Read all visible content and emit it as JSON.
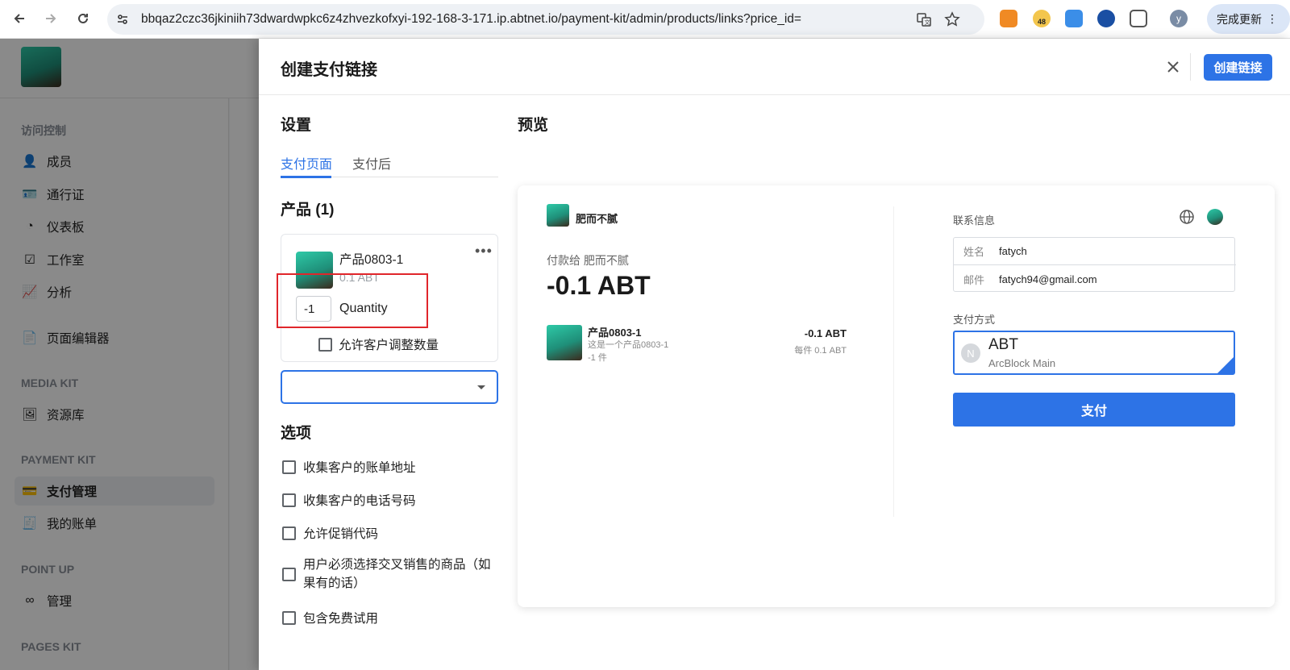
{
  "browser": {
    "url": "bbqaz2czc36jkiniih73dwardwpkc6z4zhvezkofxyi-192-168-3-171.ip.abtnet.io/payment-kit/admin/products/links?price_id=",
    "update_label": "完成更新",
    "profile_initial": "y",
    "badge_count": "48"
  },
  "sidebar": {
    "section_access": "访问控制",
    "members": "成员",
    "passport": "通行证",
    "dashboard": "仪表板",
    "studio": "工作室",
    "analytics": "分析",
    "page_editor": "页面编辑器",
    "section_media": "MEDIA KIT",
    "library": "资源库",
    "section_payment": "PAYMENT KIT",
    "payment_mgmt": "支付管理",
    "my_bills": "我的账单",
    "section_point": "POINT UP",
    "manage": "管理",
    "section_pages": "PAGES KIT"
  },
  "drawer": {
    "title": "创建支付链接",
    "create_button": "创建链接",
    "settings_heading": "设置",
    "preview_heading": "预览",
    "tabs": [
      "支付页面",
      "支付后"
    ],
    "products_heading": "产品 (1)",
    "product": {
      "name": "产品0803-1",
      "price": "0.1 ABT",
      "quantity": "-1",
      "quantity_label": "Quantity",
      "adjust_label": "允许客户调整数量"
    },
    "options_heading": "选项",
    "options": [
      "收集客户的账单地址",
      "收集客户的电话号码",
      "允许促销代码",
      "用户必须选择交叉销售的商品（如果有的话）",
      "包含免费试用"
    ]
  },
  "preview": {
    "store_name": "肥而不腻",
    "pay_to": "付款给 肥而不腻",
    "total": "-0.1 ABT",
    "item": {
      "name": "产品0803-1",
      "description": "这是一个产品0803-1",
      "quantity": "-1 件",
      "amount": "-0.1 ABT",
      "unit_price": "每件 0.1 ABT"
    },
    "contact_heading": "联系信息",
    "name_label": "姓名",
    "name_value": "fatych",
    "email_label": "邮件",
    "email_value": "fatych94@gmail.com",
    "method_heading": "支付方式",
    "method_icon_letter": "N",
    "method_name": "ABT",
    "method_network": "ArcBlock Main",
    "pay_button": "支付"
  },
  "colors": {
    "accent": "#2d73e6",
    "highlight": "#e0262b"
  }
}
